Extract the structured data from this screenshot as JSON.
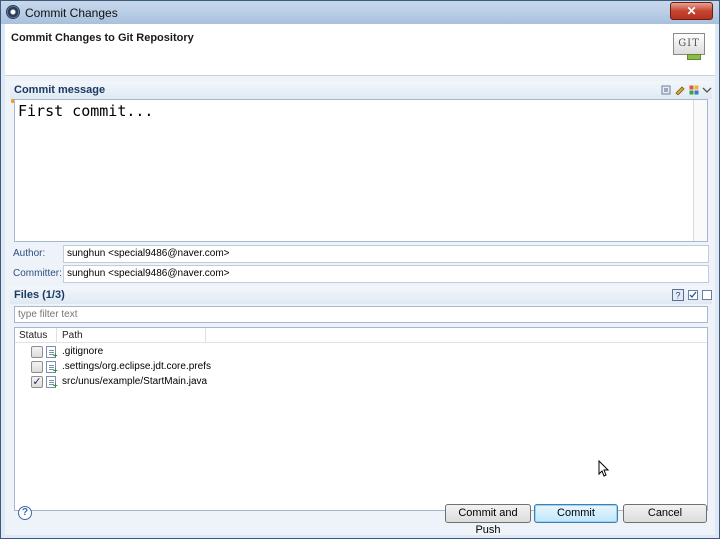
{
  "window": {
    "title": "Commit Changes"
  },
  "header": {
    "heading": "Commit Changes to Git Repository",
    "logo_text": "GIT"
  },
  "commit_message": {
    "section_label": "Commit message",
    "value": "First commit..."
  },
  "author": {
    "label": "Author:",
    "value": "sunghun <special9486@naver.com>"
  },
  "committer": {
    "label": "Committer:",
    "value": "sunghun <special9486@naver.com>"
  },
  "files": {
    "section_label": "Files (1/3)",
    "filter_placeholder": "type filter text",
    "columns": [
      "Status",
      "Path"
    ],
    "rows": [
      {
        "checked": false,
        "path": ".gitignore"
      },
      {
        "checked": false,
        "path": ".settings/org.eclipse.jdt.core.prefs"
      },
      {
        "checked": true,
        "path": "src/unus/example/StartMain.java"
      }
    ]
  },
  "buttons": {
    "commit_and_push": "Commit and Push",
    "commit": "Commit",
    "cancel": "Cancel"
  },
  "icons": {
    "close": "close-icon",
    "help": "help-icon",
    "checkmark": "✓"
  },
  "colors": {
    "section_label": "#1c3a62",
    "default_button": "#bee6fd"
  }
}
